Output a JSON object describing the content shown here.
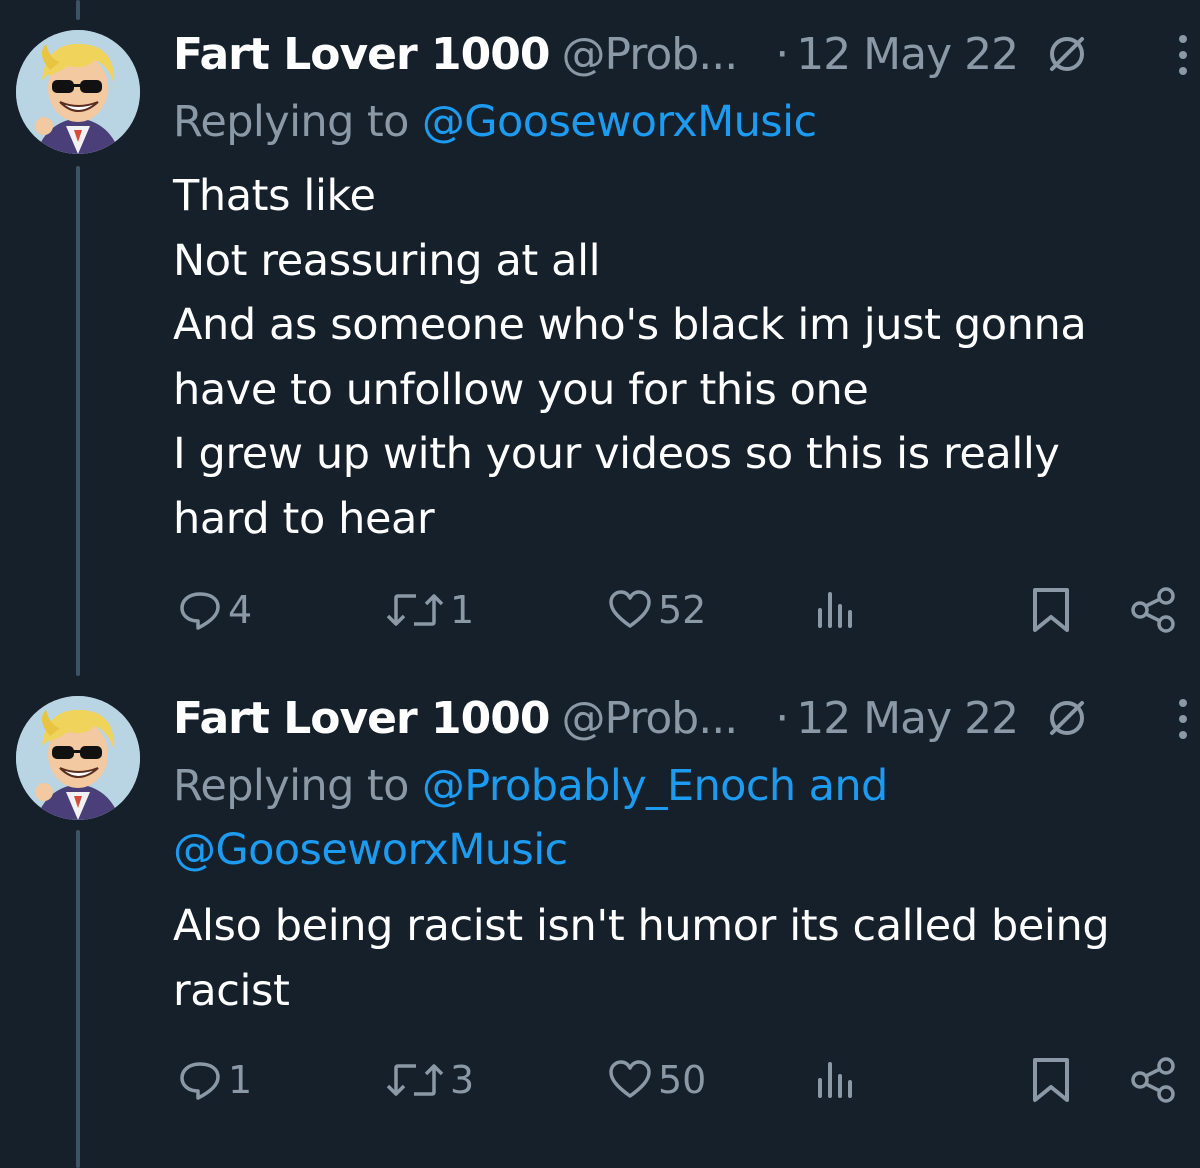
{
  "tweets": [
    {
      "display_name": "Fart Lover 1000",
      "handle": "@Prob...",
      "separator": "·",
      "date": "12 May 22",
      "reply_prefix": "Replying to",
      "reply_mentions_line1": "@GooseworxMusic",
      "body_lines": [
        "Thats like",
        "Not reassuring at all",
        "And as someone who's black im just gonna",
        "have to unfollow you for this one",
        "I grew up with your videos so this is really",
        "hard to hear"
      ],
      "stats": {
        "replies": "4",
        "retweets": "1",
        "likes": "52"
      }
    },
    {
      "display_name": "Fart Lover 1000",
      "handle": "@Prob...",
      "separator": "·",
      "date": "12 May 22",
      "reply_prefix": "Replying to",
      "reply_mentions_line1": "@Probably_Enoch and",
      "reply_mentions_line2": "@GooseworxMusic",
      "body_lines": [
        "Also being racist isn't humor its called being",
        "racist"
      ],
      "stats": {
        "replies": "1",
        "retweets": "3",
        "likes": "50"
      }
    }
  ],
  "icons": {
    "reply": "reply-icon",
    "retweet": "retweet-icon",
    "like": "heart-icon",
    "views": "views-icon",
    "bookmark": "bookmark-icon",
    "share": "share-icon",
    "more": "more-vertical-icon",
    "not_following": "circle-slash-icon"
  },
  "colors": {
    "background": "#15202b",
    "text": "#ffffff",
    "muted": "#8b98a5",
    "link": "#1d9bf0",
    "thread_line": "#3d5466"
  }
}
